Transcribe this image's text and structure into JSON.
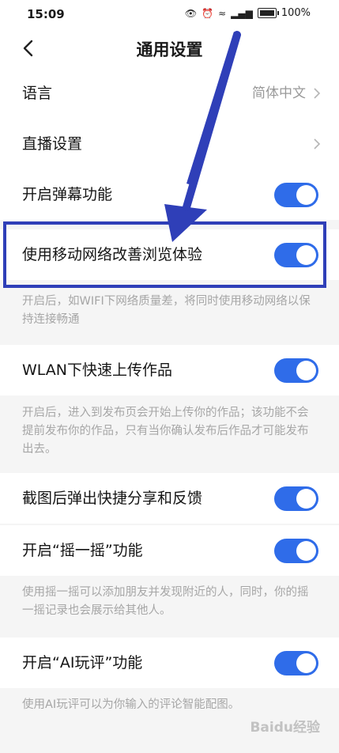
{
  "status_bar": {
    "time": "15:09",
    "battery_percent": "100%",
    "icons": [
      "eye-icon",
      "alarm-icon",
      "wifi-icon",
      "signal-icon",
      "battery-icon"
    ]
  },
  "header": {
    "title": "通用设置"
  },
  "settings": {
    "language": {
      "label": "语言",
      "value": "简体中文"
    },
    "live": {
      "label": "直播设置"
    },
    "danmaku": {
      "label": "开启弹幕功能",
      "enabled": true
    },
    "mobile_network": {
      "label": "使用移动网络改善浏览体验",
      "enabled": true,
      "note": "开启后，如WIFI下网络质量差，将同时使用移动网络以保持连接畅通"
    },
    "wlan_upload": {
      "label": "WLAN下快速上传作品",
      "enabled": true,
      "note": "开启后，进入到发布页会开始上传你的作品；该功能不会提前发布你的作品，只有当你确认发布后作品才可能发布出去。"
    },
    "screenshot_share": {
      "label": "截图后弹出快捷分享和反馈",
      "enabled": true
    },
    "shake": {
      "label": "开启“摇一摇”功能",
      "enabled": true,
      "note": "使用摇一摇可以添加朋友并发现附近的人，同时，你的摇一摇记录也会展示给其他人。"
    },
    "ai_comment": {
      "label": "开启“AI玩评”功能",
      "enabled": true,
      "note": "使用AI玩评可以为你输入的评论智能配图。"
    }
  },
  "watermark": "Baidu经验",
  "colors": {
    "toggle_on": "#2f6ce9",
    "annotation": "#2f3fb8"
  }
}
